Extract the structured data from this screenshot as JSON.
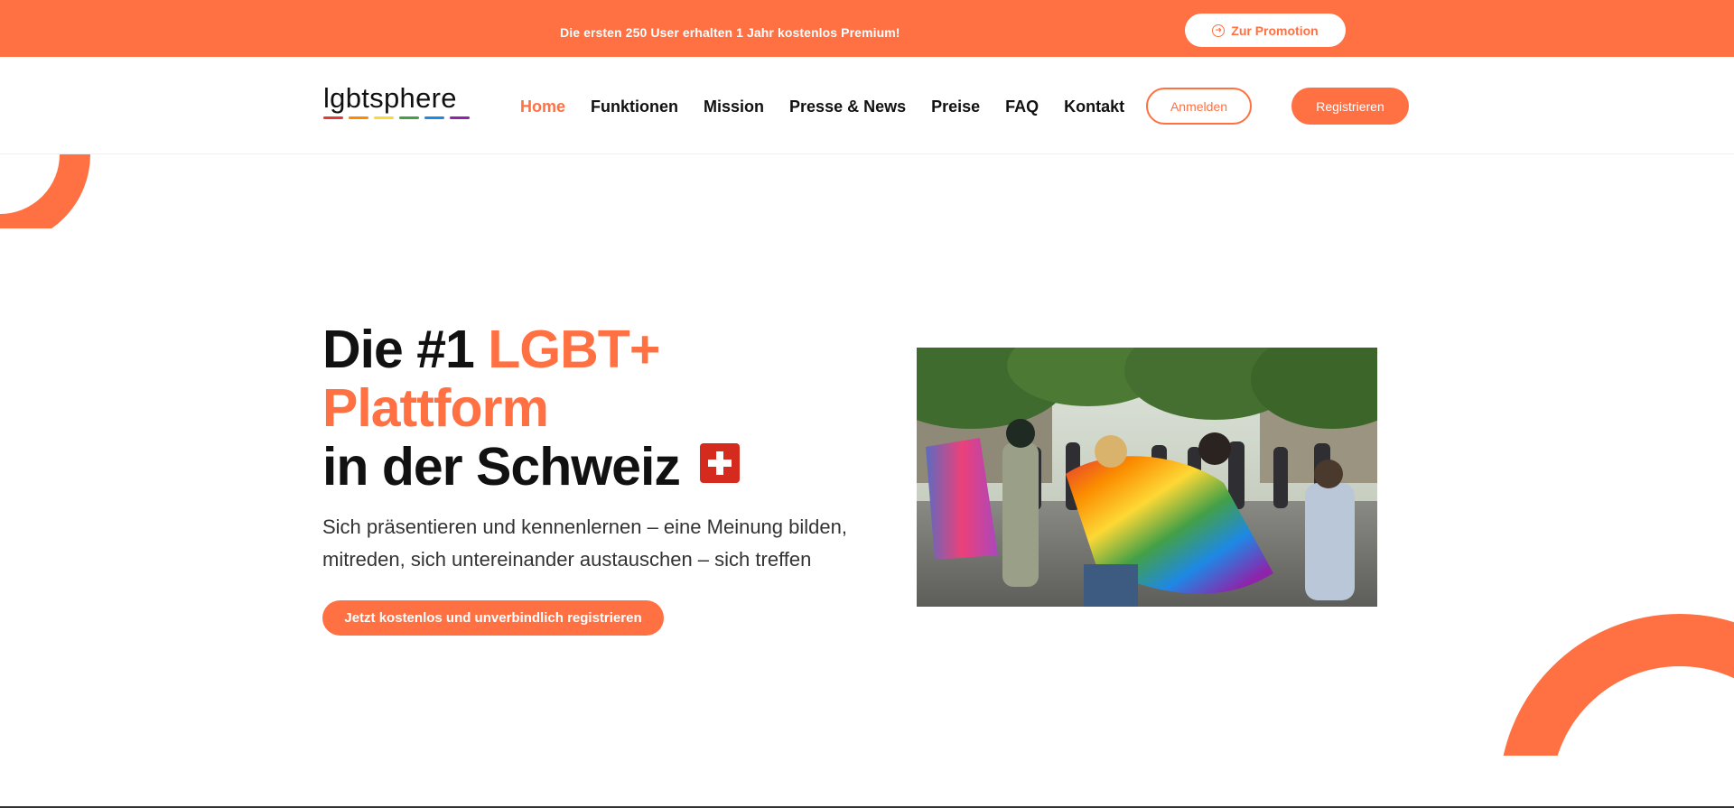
{
  "promo": {
    "text": "Die ersten 250 User erhalten 1 Jahr kostenlos Premium!",
    "button_label": "Zur Promotion",
    "button_icon": "arrow-circle-right-icon"
  },
  "header": {
    "logo_text": "lgbtsphere",
    "logo_bar_colors": [
      "#e53935",
      "#fb8c00",
      "#fdd835",
      "#43a047",
      "#1e88e5",
      "#8e24aa"
    ],
    "nav": [
      {
        "label": "Home",
        "active": true
      },
      {
        "label": "Funktionen",
        "active": false
      },
      {
        "label": "Mission",
        "active": false
      },
      {
        "label": "Presse & News",
        "active": false
      },
      {
        "label": "Preise",
        "active": false
      },
      {
        "label": "FAQ",
        "active": false
      },
      {
        "label": "Kontakt",
        "active": false
      }
    ],
    "login_label": "Anmelden",
    "register_label": "Registrieren"
  },
  "hero": {
    "title_part1": "Die #1 ",
    "title_accent_1": "LGBT+",
    "title_accent_2": "Plattform",
    "title_part3": "in der Schweiz",
    "flag_icon": "swiss-flag-icon",
    "subtitle_line1": "Sich präsentieren und kennenlernen – eine Meinung bilden,",
    "subtitle_line2": "mitreden, sich untereinander austauschen – sich treffen",
    "cta_label": "Jetzt kostenlos und unverbindlich registrieren",
    "photo": "pride-parade-photo"
  },
  "colors": {
    "accent": "#ff7043",
    "swiss_red": "#d52b1e",
    "text": "#111111"
  }
}
